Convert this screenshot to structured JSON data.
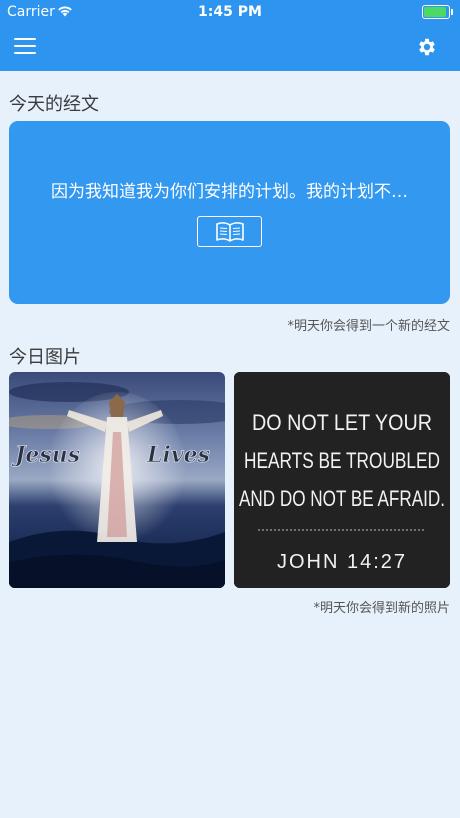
{
  "status_bar": {
    "carrier": "Carrier",
    "time": "1:45 PM",
    "battery_level": 1.0
  },
  "nav": {
    "menu_icon": "hamburger-icon",
    "settings_icon": "gear-icon",
    "bar_color": "#2d95ef"
  },
  "verse_section": {
    "title": "今天的经文",
    "verse_text": "因为我知道我为你们安排的计划。我的计划不…",
    "button_icon": "book-icon",
    "note": "*明天你会得到一个新的经文",
    "card_color": "#3298f0"
  },
  "picture_section": {
    "title": "今日图片",
    "images": [
      {
        "name": "jesus-lives-image",
        "left_text": "Jesus",
        "right_text": "Lives"
      },
      {
        "name": "verse-image",
        "lines": [
          "DO NOT LET YOUR",
          "HEARTS BE TROUBLED",
          "AND DO NOT BE AFRAID."
        ],
        "reference": "JOHN 14:27"
      }
    ],
    "note": "*明天你会得到新的照片"
  }
}
